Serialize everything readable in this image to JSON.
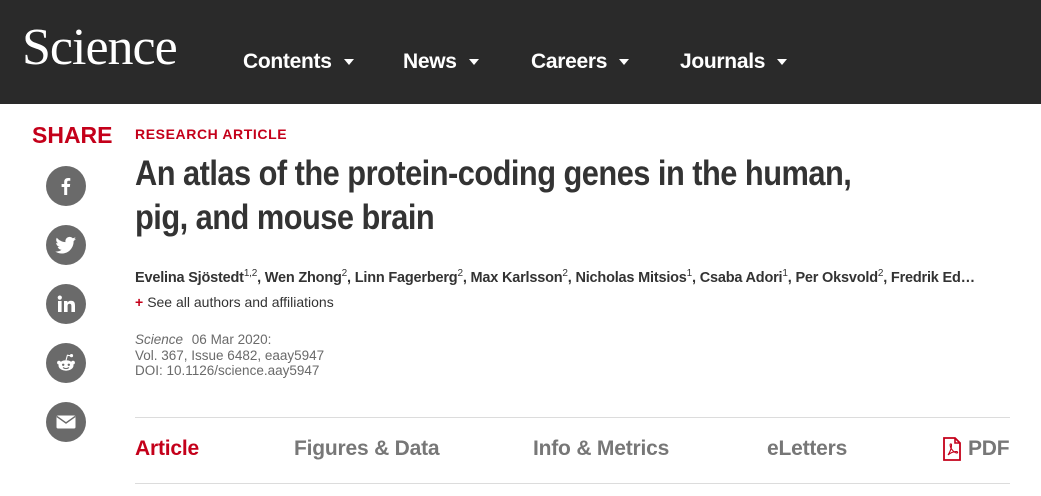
{
  "header": {
    "logo": "Science",
    "nav": [
      {
        "label": "Contents"
      },
      {
        "label": "News"
      },
      {
        "label": "Careers"
      },
      {
        "label": "Journals"
      }
    ]
  },
  "share": {
    "title": "SHARE",
    "icons": [
      "facebook-icon",
      "twitter-icon",
      "linkedin-icon",
      "reddit-icon",
      "email-icon"
    ]
  },
  "article": {
    "kicker": "RESEARCH ARTICLE",
    "title": "An atlas of the protein-coding genes in the human, pig, and mouse brain",
    "authors": [
      {
        "name": "Evelina Sjöstedt",
        "aff": "1,2"
      },
      {
        "name": "Wen Zhong",
        "aff": "2"
      },
      {
        "name": "Linn Fagerberg",
        "aff": "2"
      },
      {
        "name": "Max Karlsson",
        "aff": "2"
      },
      {
        "name": "Nicholas Mitsios",
        "aff": "1"
      },
      {
        "name": "Csaba Adori",
        "aff": "1"
      },
      {
        "name": "Per Oksvold",
        "aff": "2"
      },
      {
        "name": "Fredrik Ed…",
        "aff": ""
      }
    ],
    "see_all": "See all authors and affiliations",
    "journal": "Science",
    "date": "06 Mar 2020:",
    "volume": "Vol. 367, Issue 6482, eaay5947",
    "doi": "DOI: 10.1126/science.aay5947"
  },
  "tabs": [
    {
      "label": "Article"
    },
    {
      "label": "Figures & Data"
    },
    {
      "label": "Info & Metrics"
    },
    {
      "label": "eLetters"
    },
    {
      "label": "PDF"
    }
  ],
  "colors": {
    "accent": "#c4001a",
    "header_bg": "#2a2a2a",
    "icon_bg": "#6a6a6a"
  }
}
